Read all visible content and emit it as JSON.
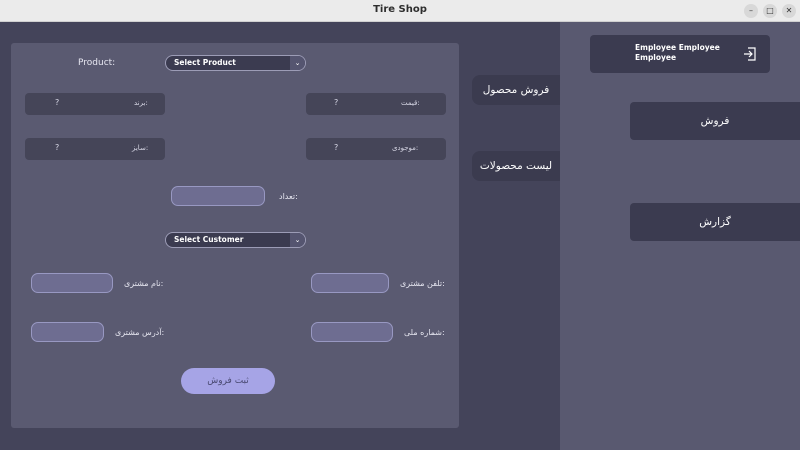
{
  "window": {
    "title": "Tire Shop",
    "min_glyph": "–",
    "max_glyph": "□",
    "close_glyph": "✕"
  },
  "form": {
    "product_label": "Product:",
    "product_select": "Select Product",
    "brand_label": "برند:",
    "brand_value": "?",
    "price_label": "قیمت:",
    "price_value": "?",
    "size_label": "سایز:",
    "size_value": "?",
    "stock_label": "موجودی:",
    "stock_value": "?",
    "quantity_label": "تعداد:",
    "customer_select": "Select Customer",
    "customer_name_label": "نام مشتری:",
    "customer_phone_label": "تلفن مشتری:",
    "customer_address_label": "آدرس مشتری:",
    "national_id_label": "شماره ملی:",
    "submit_label": "ثبت فروش"
  },
  "tabs": [
    {
      "label": "فروش محصول"
    },
    {
      "label": "لیست محصولات"
    }
  ],
  "sidebar": {
    "user_name": "Employee Employee Employee",
    "items": [
      {
        "label": "فروش"
      },
      {
        "label": "گزارش"
      }
    ]
  },
  "dropdown_glyph": "⌄",
  "colors": {
    "accent": "#a6a4e6",
    "panel": "#5a5a71",
    "dark": "#3b3b50"
  }
}
